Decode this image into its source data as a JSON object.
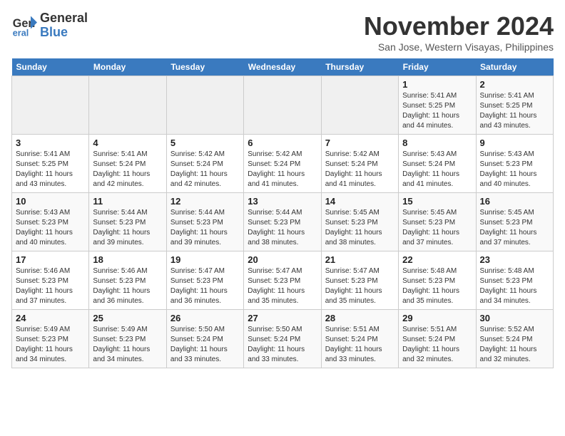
{
  "logo": {
    "line1": "General",
    "line2": "Blue"
  },
  "title": "November 2024",
  "location": "San Jose, Western Visayas, Philippines",
  "weekdays": [
    "Sunday",
    "Monday",
    "Tuesday",
    "Wednesday",
    "Thursday",
    "Friday",
    "Saturday"
  ],
  "weeks": [
    [
      {
        "day": "",
        "detail": ""
      },
      {
        "day": "",
        "detail": ""
      },
      {
        "day": "",
        "detail": ""
      },
      {
        "day": "",
        "detail": ""
      },
      {
        "day": "",
        "detail": ""
      },
      {
        "day": "1",
        "detail": "Sunrise: 5:41 AM\nSunset: 5:25 PM\nDaylight: 11 hours\nand 44 minutes."
      },
      {
        "day": "2",
        "detail": "Sunrise: 5:41 AM\nSunset: 5:25 PM\nDaylight: 11 hours\nand 43 minutes."
      }
    ],
    [
      {
        "day": "3",
        "detail": "Sunrise: 5:41 AM\nSunset: 5:25 PM\nDaylight: 11 hours\nand 43 minutes."
      },
      {
        "day": "4",
        "detail": "Sunrise: 5:41 AM\nSunset: 5:24 PM\nDaylight: 11 hours\nand 42 minutes."
      },
      {
        "day": "5",
        "detail": "Sunrise: 5:42 AM\nSunset: 5:24 PM\nDaylight: 11 hours\nand 42 minutes."
      },
      {
        "day": "6",
        "detail": "Sunrise: 5:42 AM\nSunset: 5:24 PM\nDaylight: 11 hours\nand 41 minutes."
      },
      {
        "day": "7",
        "detail": "Sunrise: 5:42 AM\nSunset: 5:24 PM\nDaylight: 11 hours\nand 41 minutes."
      },
      {
        "day": "8",
        "detail": "Sunrise: 5:43 AM\nSunset: 5:24 PM\nDaylight: 11 hours\nand 41 minutes."
      },
      {
        "day": "9",
        "detail": "Sunrise: 5:43 AM\nSunset: 5:23 PM\nDaylight: 11 hours\nand 40 minutes."
      }
    ],
    [
      {
        "day": "10",
        "detail": "Sunrise: 5:43 AM\nSunset: 5:23 PM\nDaylight: 11 hours\nand 40 minutes."
      },
      {
        "day": "11",
        "detail": "Sunrise: 5:44 AM\nSunset: 5:23 PM\nDaylight: 11 hours\nand 39 minutes."
      },
      {
        "day": "12",
        "detail": "Sunrise: 5:44 AM\nSunset: 5:23 PM\nDaylight: 11 hours\nand 39 minutes."
      },
      {
        "day": "13",
        "detail": "Sunrise: 5:44 AM\nSunset: 5:23 PM\nDaylight: 11 hours\nand 38 minutes."
      },
      {
        "day": "14",
        "detail": "Sunrise: 5:45 AM\nSunset: 5:23 PM\nDaylight: 11 hours\nand 38 minutes."
      },
      {
        "day": "15",
        "detail": "Sunrise: 5:45 AM\nSunset: 5:23 PM\nDaylight: 11 hours\nand 37 minutes."
      },
      {
        "day": "16",
        "detail": "Sunrise: 5:45 AM\nSunset: 5:23 PM\nDaylight: 11 hours\nand 37 minutes."
      }
    ],
    [
      {
        "day": "17",
        "detail": "Sunrise: 5:46 AM\nSunset: 5:23 PM\nDaylight: 11 hours\nand 37 minutes."
      },
      {
        "day": "18",
        "detail": "Sunrise: 5:46 AM\nSunset: 5:23 PM\nDaylight: 11 hours\nand 36 minutes."
      },
      {
        "day": "19",
        "detail": "Sunrise: 5:47 AM\nSunset: 5:23 PM\nDaylight: 11 hours\nand 36 minutes."
      },
      {
        "day": "20",
        "detail": "Sunrise: 5:47 AM\nSunset: 5:23 PM\nDaylight: 11 hours\nand 35 minutes."
      },
      {
        "day": "21",
        "detail": "Sunrise: 5:47 AM\nSunset: 5:23 PM\nDaylight: 11 hours\nand 35 minutes."
      },
      {
        "day": "22",
        "detail": "Sunrise: 5:48 AM\nSunset: 5:23 PM\nDaylight: 11 hours\nand 35 minutes."
      },
      {
        "day": "23",
        "detail": "Sunrise: 5:48 AM\nSunset: 5:23 PM\nDaylight: 11 hours\nand 34 minutes."
      }
    ],
    [
      {
        "day": "24",
        "detail": "Sunrise: 5:49 AM\nSunset: 5:23 PM\nDaylight: 11 hours\nand 34 minutes."
      },
      {
        "day": "25",
        "detail": "Sunrise: 5:49 AM\nSunset: 5:23 PM\nDaylight: 11 hours\nand 34 minutes."
      },
      {
        "day": "26",
        "detail": "Sunrise: 5:50 AM\nSunset: 5:24 PM\nDaylight: 11 hours\nand 33 minutes."
      },
      {
        "day": "27",
        "detail": "Sunrise: 5:50 AM\nSunset: 5:24 PM\nDaylight: 11 hours\nand 33 minutes."
      },
      {
        "day": "28",
        "detail": "Sunrise: 5:51 AM\nSunset: 5:24 PM\nDaylight: 11 hours\nand 33 minutes."
      },
      {
        "day": "29",
        "detail": "Sunrise: 5:51 AM\nSunset: 5:24 PM\nDaylight: 11 hours\nand 32 minutes."
      },
      {
        "day": "30",
        "detail": "Sunrise: 5:52 AM\nSunset: 5:24 PM\nDaylight: 11 hours\nand 32 minutes."
      }
    ]
  ]
}
